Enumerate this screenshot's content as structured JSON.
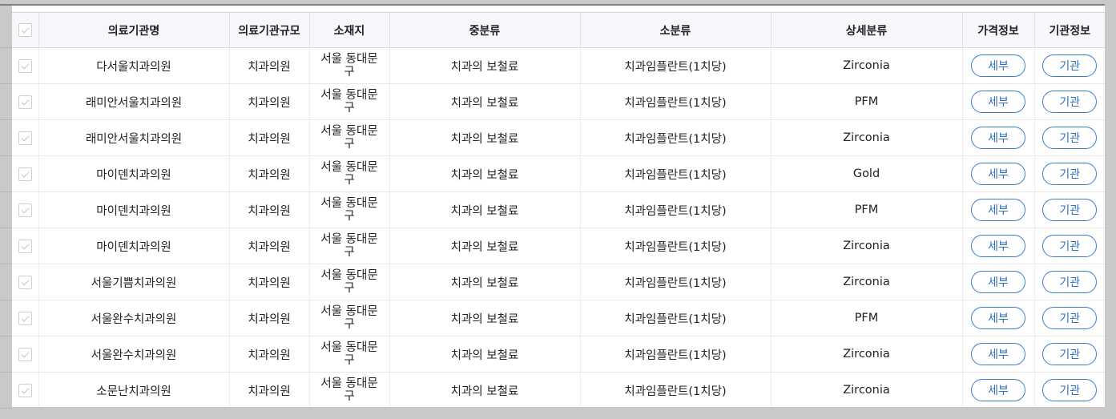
{
  "table": {
    "headers": [
      "의료기관명",
      "의료기관규모",
      "소재지",
      "중분류",
      "소분류",
      "상세분류",
      "가격정보",
      "기관정보"
    ],
    "rows": [
      {
        "name": "다서울치과의원",
        "scale": "치과의원",
        "location": "서울 동대문구",
        "middle": "치과의 보철료",
        "sub": "치과임플란트(1치당)",
        "detail": "Zirconia",
        "price_btn": "세부",
        "inst_btn": "기관"
      },
      {
        "name": "래미안서울치과의원",
        "scale": "치과의원",
        "location": "서울 동대문구",
        "middle": "치과의 보철료",
        "sub": "치과임플란트(1치당)",
        "detail": "PFM",
        "price_btn": "세부",
        "inst_btn": "기관"
      },
      {
        "name": "래미안서울치과의원",
        "scale": "치과의원",
        "location": "서울 동대문구",
        "middle": "치과의 보철료",
        "sub": "치과임플란트(1치당)",
        "detail": "Zirconia",
        "price_btn": "세부",
        "inst_btn": "기관"
      },
      {
        "name": "마이덴치과의원",
        "scale": "치과의원",
        "location": "서울 동대문구",
        "middle": "치과의 보철료",
        "sub": "치과임플란트(1치당)",
        "detail": "Gold",
        "price_btn": "세부",
        "inst_btn": "기관"
      },
      {
        "name": "마이덴치과의원",
        "scale": "치과의원",
        "location": "서울 동대문구",
        "middle": "치과의 보철료",
        "sub": "치과임플란트(1치당)",
        "detail": "PFM",
        "price_btn": "세부",
        "inst_btn": "기관"
      },
      {
        "name": "마이덴치과의원",
        "scale": "치과의원",
        "location": "서울 동대문구",
        "middle": "치과의 보철료",
        "sub": "치과임플란트(1치당)",
        "detail": "Zirconia",
        "price_btn": "세부",
        "inst_btn": "기관"
      },
      {
        "name": "서울기쁨치과의원",
        "scale": "치과의원",
        "location": "서울 동대문구",
        "middle": "치과의 보철료",
        "sub": "치과임플란트(1치당)",
        "detail": "Zirconia",
        "price_btn": "세부",
        "inst_btn": "기관"
      },
      {
        "name": "서울완수치과의원",
        "scale": "치과의원",
        "location": "서울 동대문구",
        "middle": "치과의 보철료",
        "sub": "치과임플란트(1치당)",
        "detail": "PFM",
        "price_btn": "세부",
        "inst_btn": "기관"
      },
      {
        "name": "서울완수치과의원",
        "scale": "치과의원",
        "location": "서울 동대문구",
        "middle": "치과의 보철료",
        "sub": "치과임플란트(1치당)",
        "detail": "Zirconia",
        "price_btn": "세부",
        "inst_btn": "기관"
      },
      {
        "name": "소문난치과의원",
        "scale": "치과의원",
        "location": "서울 동대문구",
        "middle": "치과의 보철료",
        "sub": "치과임플란트(1치당)",
        "detail": "Zirconia",
        "price_btn": "세부",
        "inst_btn": "기관"
      }
    ]
  }
}
